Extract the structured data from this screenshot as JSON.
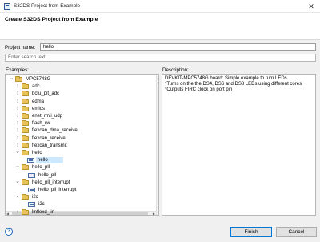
{
  "window": {
    "title": "S32DS Project from Example",
    "close_glyph": "✕"
  },
  "dialog": {
    "heading": "Create S32DS Project from Example"
  },
  "project_name": {
    "label": "Project name:",
    "value": "hello"
  },
  "filter": {
    "placeholder": "Enter search text..."
  },
  "examples": {
    "label": "Examples:",
    "items": [
      {
        "label": "MPC5748G",
        "kind": "folder",
        "expanded": true,
        "level": 0
      },
      {
        "label": "adc",
        "kind": "folder",
        "expanded": false,
        "level": 1
      },
      {
        "label": "bctu_pit_adc",
        "kind": "folder",
        "expanded": false,
        "level": 1
      },
      {
        "label": "edma",
        "kind": "folder",
        "expanded": false,
        "level": 1
      },
      {
        "label": "emios",
        "kind": "folder",
        "expanded": false,
        "level": 1
      },
      {
        "label": "enet_rmii_udp",
        "kind": "folder",
        "expanded": false,
        "level": 1
      },
      {
        "label": "flash_rw",
        "kind": "folder",
        "expanded": false,
        "level": 1
      },
      {
        "label": "flexcan_dma_receive",
        "kind": "folder",
        "expanded": false,
        "level": 1
      },
      {
        "label": "flexcan_receive",
        "kind": "folder",
        "expanded": false,
        "level": 1
      },
      {
        "label": "flexcan_transmit",
        "kind": "folder",
        "expanded": false,
        "level": 1
      },
      {
        "label": "hello",
        "kind": "folder",
        "expanded": true,
        "level": 1
      },
      {
        "label": "hello",
        "kind": "project",
        "selected": true,
        "level": 2
      },
      {
        "label": "hello_pll",
        "kind": "folder",
        "expanded": true,
        "level": 1
      },
      {
        "label": "hello_pll",
        "kind": "project",
        "level": 2
      },
      {
        "label": "hello_pll_interrupt",
        "kind": "folder",
        "expanded": true,
        "level": 1
      },
      {
        "label": "hello_pll_interrupt",
        "kind": "project",
        "level": 2
      },
      {
        "label": "i2c",
        "kind": "folder",
        "expanded": true,
        "level": 1
      },
      {
        "label": "i2c",
        "kind": "project",
        "level": 2
      },
      {
        "label": "linflexd_lin",
        "kind": "folder",
        "expanded": false,
        "level": 1
      }
    ]
  },
  "description": {
    "label": "Description:",
    "lines": [
      "DEVKIT-MPC5748G board: Simple example to turn LEDs",
      "*Turns on the the DS4, DS6 and DS8 LEDs using different cores",
      "*Outputs FIRC clock on port pin"
    ]
  },
  "buttons": {
    "help": "?",
    "finish": "Finish",
    "cancel": "Cancel"
  },
  "colors": {
    "selection": "#cce8ff",
    "folder": "#e7c45a",
    "accent": "#0078d7"
  }
}
